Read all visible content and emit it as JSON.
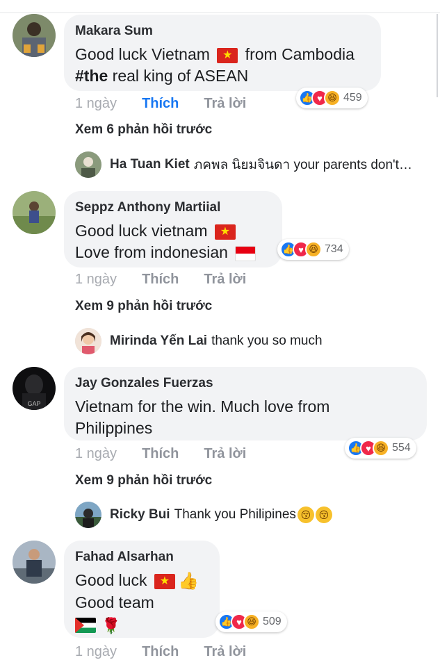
{
  "comments": [
    {
      "author": "Makara Sum",
      "text_line1_before": "Good luck Vietnam ",
      "text_line1_after": " from Cambodia",
      "text_line2_bold": "#the",
      "text_line2_rest": " real king of ASEAN",
      "reaction_count": "459",
      "time": "1 ngày",
      "like_label": "Thích",
      "reply_label": "Trả lời",
      "prev_replies": "Xem 6 phản hồi trước",
      "reply": {
        "name": "Ha Tuan Kiet",
        "text": "ภคพล นิยมจินดา your parents don't…"
      }
    },
    {
      "author": "Seppz Anthony Martiial",
      "text_line1": "Good luck vietnam ",
      "text_line2": "Love from indonesian ",
      "reaction_count": "734",
      "time": "1 ngày",
      "like_label": "Thích",
      "reply_label": "Trả lời",
      "prev_replies": "Xem 9 phản hồi trước",
      "reply": {
        "name": "Mirinda Yến Lai",
        "text": "thank you so much"
      }
    },
    {
      "author": "Jay Gonzales Fuerzas",
      "text_line1": "Vietnam for the win. Much love from",
      "text_line2": "Philippines",
      "reaction_count": "554",
      "time": "1 ngày",
      "like_label": "Thích",
      "reply_label": "Trả lời",
      "prev_replies": "Xem 9 phản hồi trước",
      "reply": {
        "name": "Ricky Bui",
        "text": "Thank you Philipines "
      }
    },
    {
      "author": "Fahad Alsarhan",
      "text_line1": "Good luck ",
      "text_line2": "Good team",
      "reaction_count": "509",
      "time": "1 ngày",
      "like_label": "Thích",
      "reply_label": "Trả lời"
    }
  ],
  "icons": {
    "reactions": [
      "like-icon",
      "love-icon",
      "haha-icon"
    ],
    "flags": [
      "vietnam-flag-icon",
      "indonesia-flag-icon",
      "palestine-flag-icon"
    ]
  },
  "colors": {
    "active_like": "#1877f2",
    "bubble": "#f2f3f5",
    "muted": "#90949c"
  }
}
